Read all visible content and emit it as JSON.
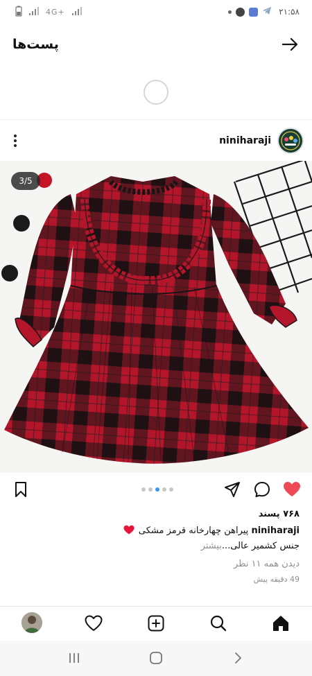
{
  "status_bar": {
    "time": "۲۱:۵۸",
    "network": "4G+"
  },
  "top_nav": {
    "title": "پست‌ها",
    "back_icon": "arrow-right-icon"
  },
  "post": {
    "username": "niniharaji",
    "more_icon": "more-vertical-icon",
    "avatar_icon": "brand-logo",
    "image": {
      "counter": "3/5",
      "subject": "red and black plaid girls dress with ruffle collar",
      "colors": {
        "red": "#b3162a",
        "black": "#1b1416",
        "background": "#f5f5f4"
      }
    },
    "carousel": {
      "count": 5,
      "active": 2
    },
    "actions": {
      "like_icon": "heart-filled-icon",
      "comment_icon": "comment-icon",
      "share_icon": "send-icon",
      "save_icon": "bookmark-icon",
      "like_color": "#ed4956"
    },
    "likes": "۷۶۸ پسند",
    "caption": {
      "username": "niniharaji",
      "line1": "پیراهن چهارخانه قرمز مشکی",
      "line2": "جنس کشمیر عالی...",
      "more": "بیشتر"
    },
    "view_comments": "دیدن همه ۱۱ نظر",
    "time_ago": "49 دقیقه پیش"
  },
  "bottom_nav": {
    "items": [
      "home-icon",
      "search-icon",
      "add-post-icon",
      "activity-heart-icon",
      "profile-avatar"
    ]
  },
  "android_nav": {
    "items": [
      "recent-apps-icon",
      "home-button-icon",
      "back-chevron-icon"
    ]
  },
  "colors": {
    "accent_blue": "#3897f0",
    "text": "#262626",
    "secondary_text": "#8e8e8e"
  }
}
